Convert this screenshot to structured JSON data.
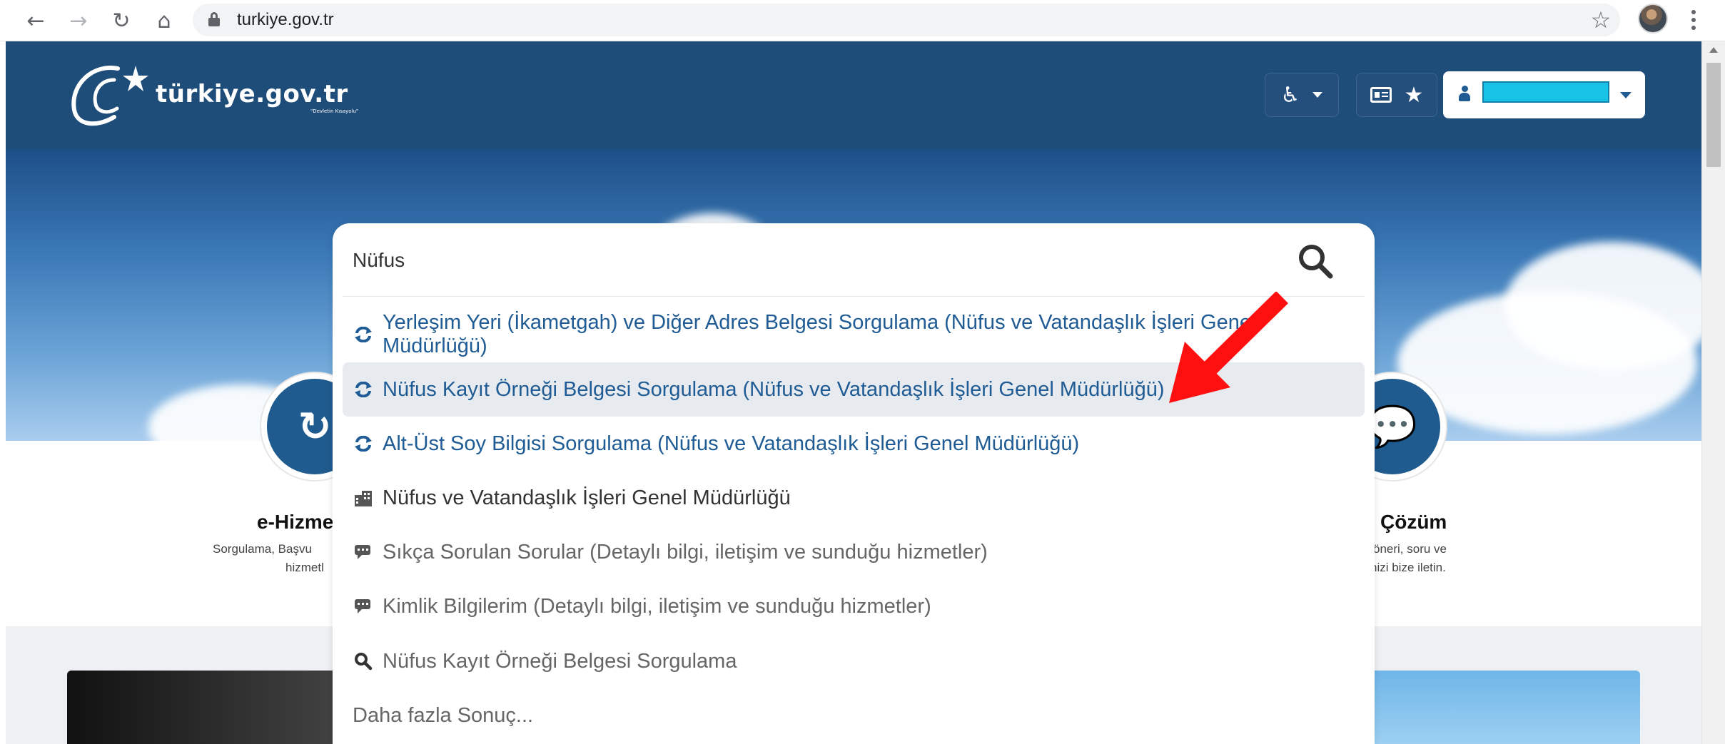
{
  "browser": {
    "url": "turkiye.gov.tr",
    "back_icon": "←",
    "forward_icon": "→",
    "reload_icon": "↻",
    "home_icon": "⌂",
    "bookmark_icon": "☆"
  },
  "header": {
    "logo_text": "türkiye.gov.tr",
    "logo_subtitle": "\"Devletin Kısayolu\"",
    "accessibility_icon": "♿",
    "favorite_icon": "★",
    "id_card_icon": "▤"
  },
  "services": {
    "left_title": "e-Hizme",
    "left_desc_line1": "Sorgulama, Başvu",
    "left_desc_line2": "hizmetl",
    "right_title": "Çözüm",
    "right_desc_line1": "öneri, soru ve",
    "right_desc_line2": "nizi bize iletin."
  },
  "search": {
    "query": "Nüfus",
    "results": [
      {
        "label": "Yerleşim Yeri (İkametgah) ve Diğer Adres Belgesi Sorgulama (Nüfus ve Vatandaşlık İşleri Genel Müdürlüğü)",
        "icon": "service-refresh-icon",
        "style": "link"
      },
      {
        "label": "Nüfus Kayıt Örneği Belgesi Sorgulama (Nüfus ve Vatandaşlık İşleri Genel Müdürlüğü)",
        "icon": "service-refresh-icon",
        "style": "link",
        "highlighted": true
      },
      {
        "label": "Alt-Üst Soy Bilgisi Sorgulama (Nüfus ve Vatandaşlık İşleri Genel Müdürlüğü)",
        "icon": "service-refresh-icon",
        "style": "link"
      },
      {
        "label": "Nüfus ve Vatandaşlık İşleri Genel Müdürlüğü",
        "icon": "building-icon",
        "style": "dark"
      },
      {
        "label": "Sıkça Sorulan Sorular (Detaylı bilgi, iletişim ve sunduğu hizmetler)",
        "icon": "chat-icon",
        "style": "grey"
      },
      {
        "label": "Kimlik Bilgilerim (Detaylı bilgi, iletişim ve sunduğu hizmetler)",
        "icon": "chat-icon",
        "style": "grey"
      },
      {
        "label": "Nüfus Kayıt Örneği Belgesi Sorgulama",
        "icon": "search-icon",
        "style": "grey"
      },
      {
        "label": "Daha fazla Sonuç...",
        "icon": "",
        "style": "grey"
      }
    ]
  },
  "colors": {
    "brand_blue": "#1f4d7a",
    "link_blue": "#1f5b94",
    "highlight_bg": "#e7ebef",
    "annotation_red": "#ff1010"
  }
}
